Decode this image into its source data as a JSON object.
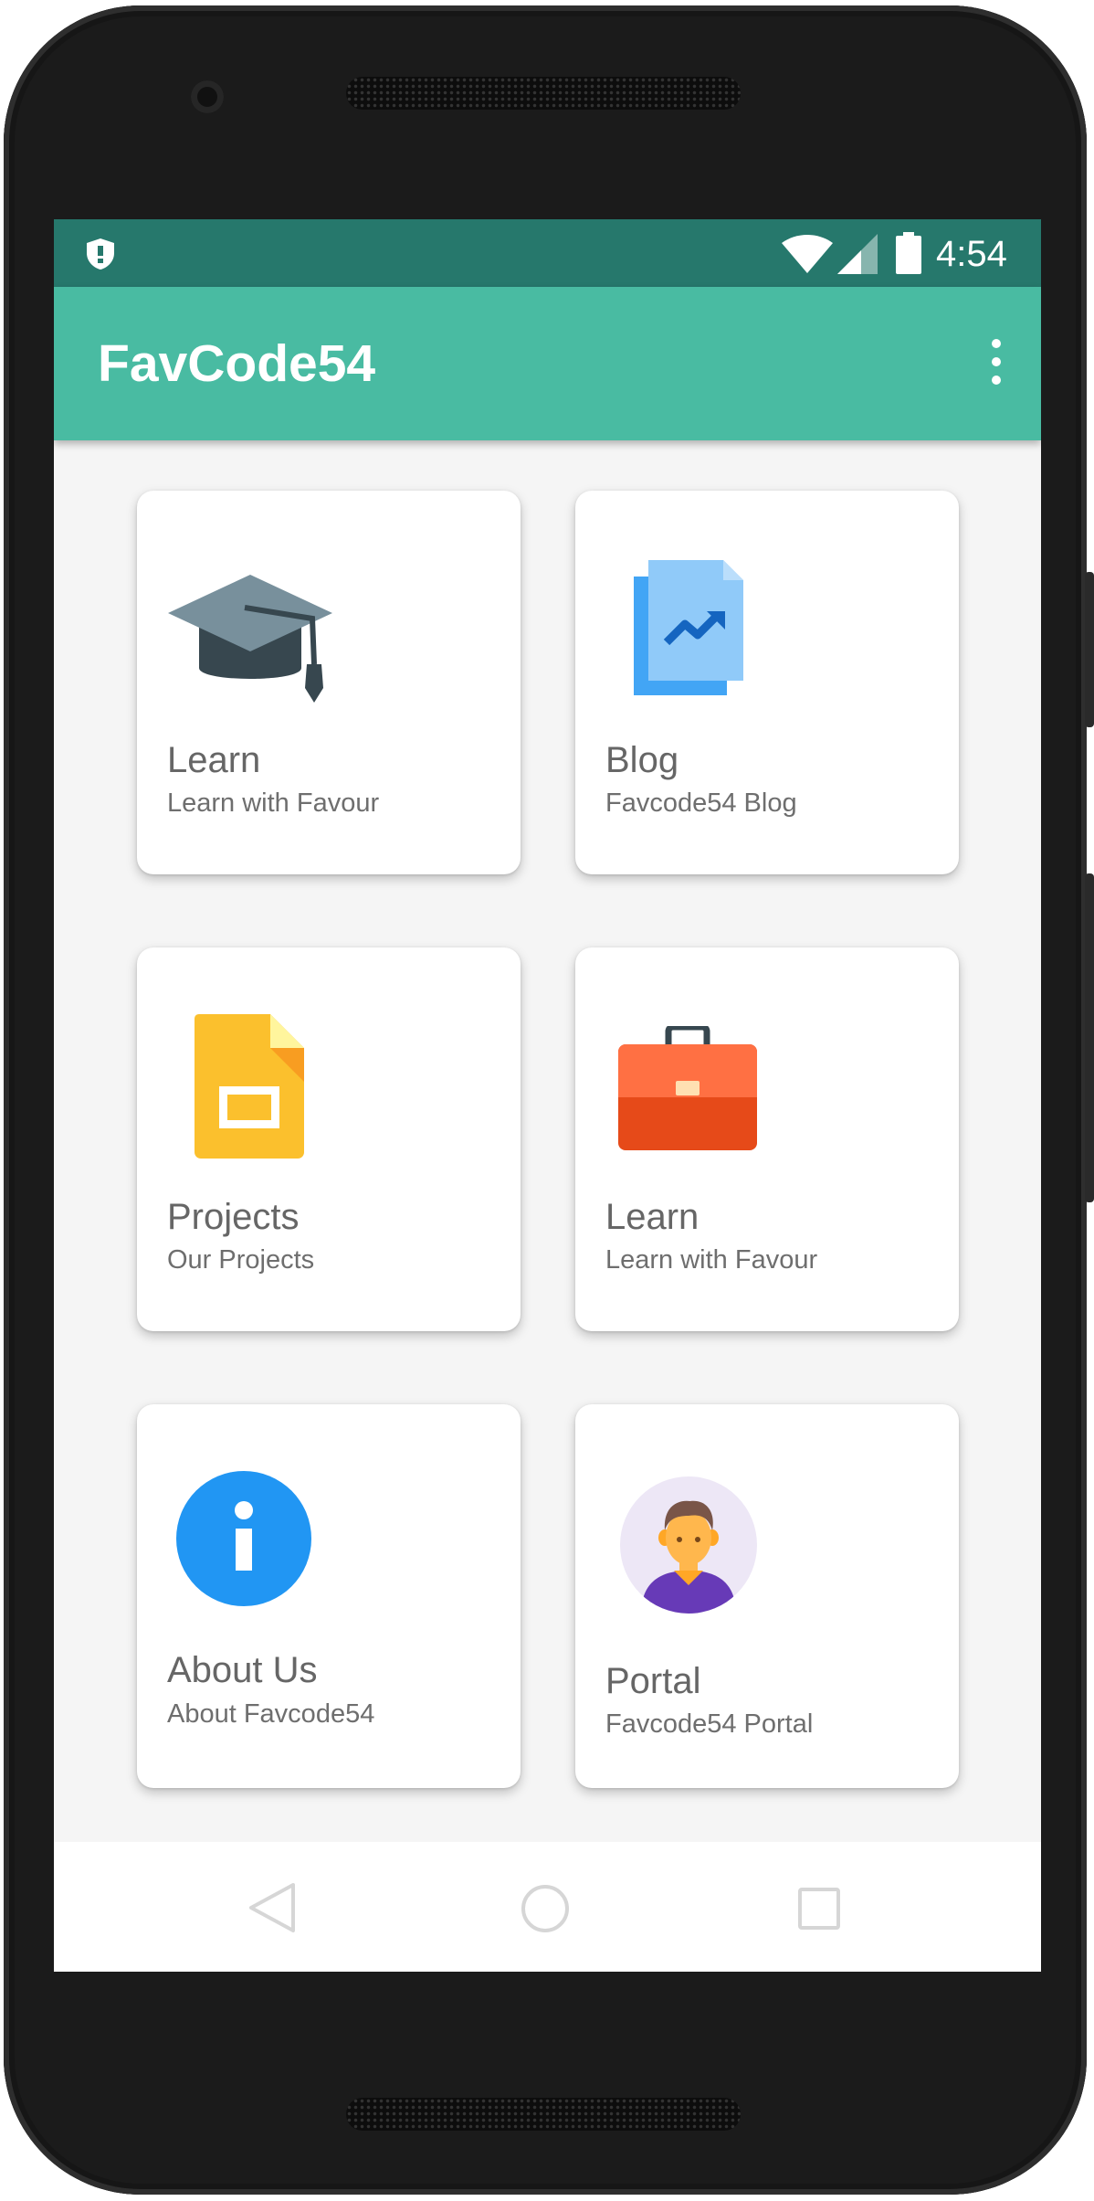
{
  "status_bar": {
    "time": "4:54"
  },
  "app_bar": {
    "title": "FavCode54"
  },
  "cards": [
    {
      "title": "Learn",
      "subtitle": "Learn with Favour",
      "icon": "graduation-cap-icon"
    },
    {
      "title": "Blog",
      "subtitle": "Favcode54 Blog",
      "icon": "document-chart-icon"
    },
    {
      "title": "Projects",
      "subtitle": "Our Projects",
      "icon": "slides-file-icon"
    },
    {
      "title": "Learn",
      "subtitle": "Learn with Favour",
      "icon": "briefcase-icon"
    },
    {
      "title": "About Us",
      "subtitle": "About Favcode54",
      "icon": "info-icon"
    },
    {
      "title": "Portal",
      "subtitle": "Favcode54 Portal",
      "icon": "user-avatar-icon"
    }
  ],
  "colors": {
    "status_bar": "#26786c",
    "app_bar": "#49bba2",
    "background": "#f5f5f5"
  }
}
